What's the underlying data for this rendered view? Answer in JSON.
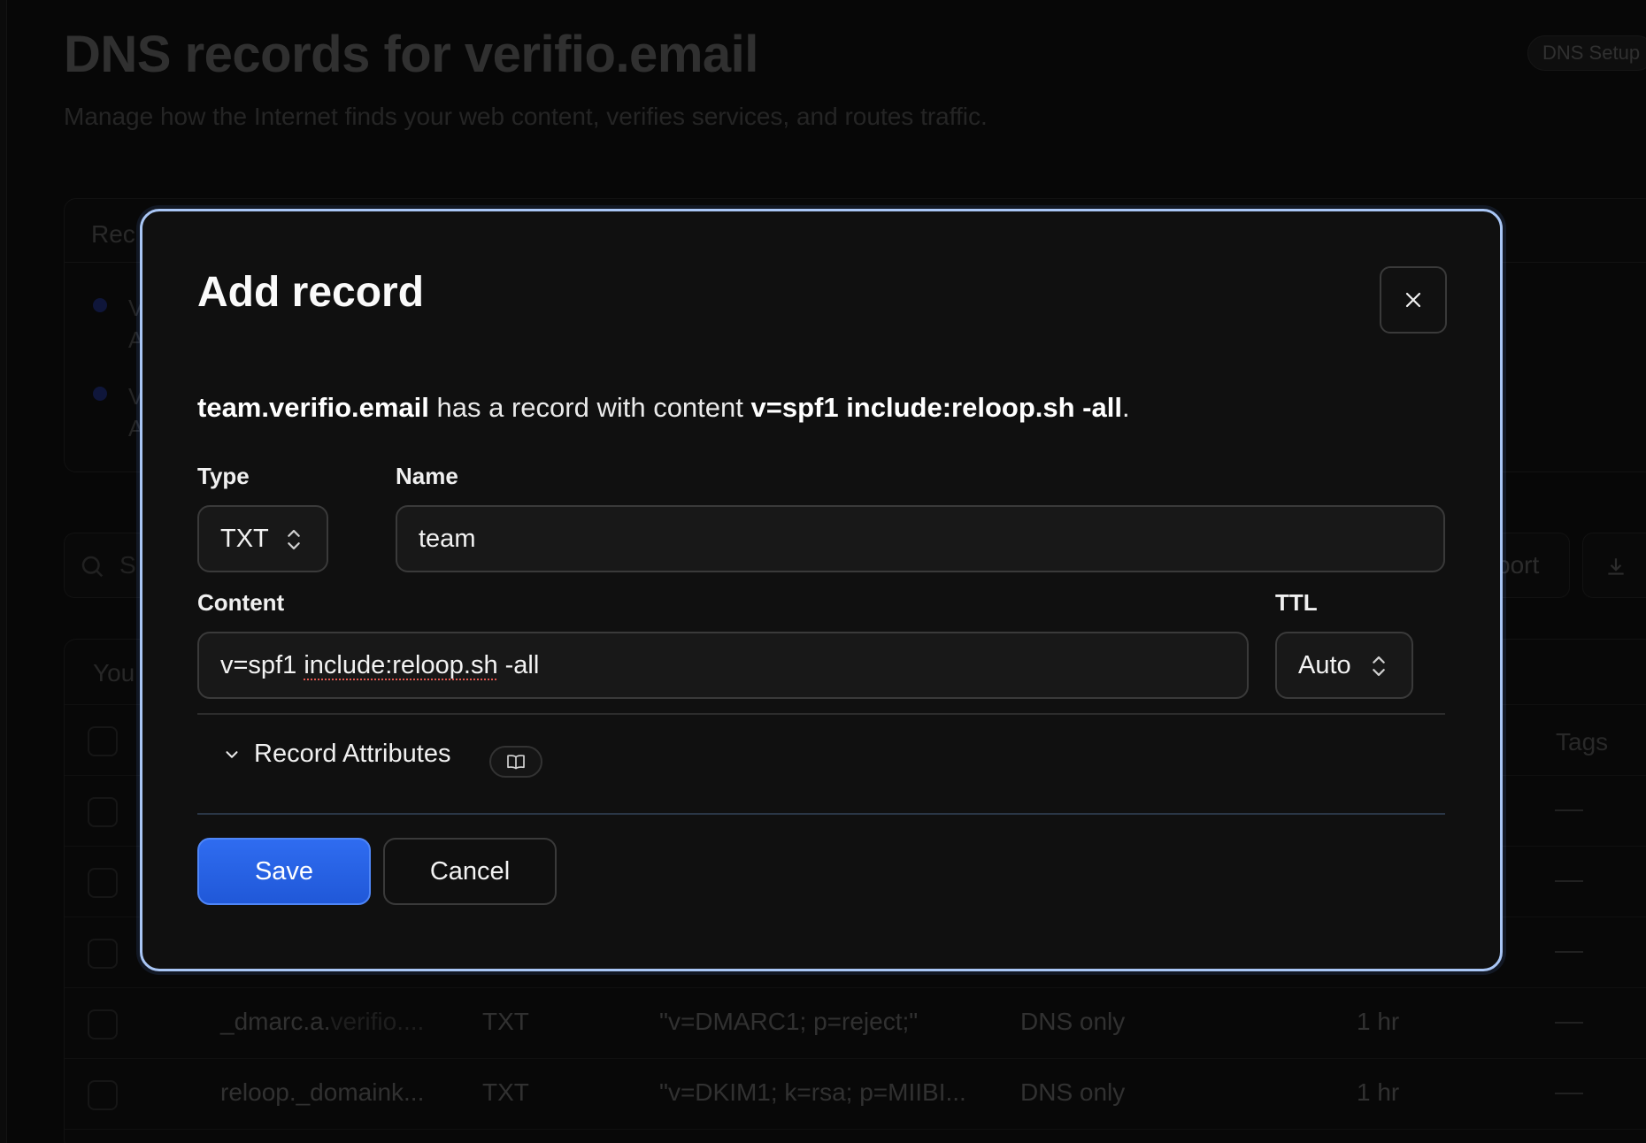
{
  "background": {
    "page_title": "DNS records for verifio.email",
    "page_subtitle": "Manage how the Internet finds your web content, verifies services, and routes traffic.",
    "badge": "DNS Setup",
    "panel_header": "Rec",
    "panel_items": [
      {
        "line1": "V",
        "line2": "A"
      },
      {
        "line1": "V",
        "line2": "A"
      }
    ],
    "search_placeholder": "S",
    "import_label": "port",
    "export_label": "E",
    "table_caption": "You",
    "tags_header": "Tags",
    "rows": [
      {
        "name": "_dmarc.a.",
        "name_dim": "verifio....",
        "type": "TXT",
        "content": "\"v=DMARC1; p=reject;\"",
        "proxy": "DNS only",
        "ttl": "1 hr",
        "tags": "—"
      },
      {
        "name": "reloop._domaink...",
        "name_dim": "",
        "type": "TXT",
        "content": "\"v=DKIM1; k=rsa; p=MIIBI...",
        "proxy": "DNS only",
        "ttl": "1 hr",
        "tags": "—"
      }
    ]
  },
  "modal": {
    "title": "Add record",
    "description": {
      "name": "team.verifio.email",
      "middle": " has a record with content ",
      "content": "v=spf1 include:reloop.sh -all",
      "end": "."
    },
    "type_label": "Type",
    "type_value": "TXT",
    "name_label": "Name",
    "name_value": "team",
    "content_label": "Content",
    "content_value_part1": "v=spf1 ",
    "content_value_squiggle": "include:reloop.sh",
    "content_value_part2": " -all",
    "ttl_label": "TTL",
    "ttl_value": "Auto",
    "attributes_label": "Record Attributes",
    "save_label": "Save",
    "cancel_label": "Cancel"
  },
  "icons": {
    "close": "close-icon",
    "chevron_updown": "chevron-updown-icon",
    "chevron_down": "chevron-down-icon",
    "book": "book-icon",
    "search": "search-icon",
    "download": "download-icon"
  },
  "colors": {
    "modal_border": "#a9c6f5",
    "primary": "#2563eb",
    "background": "#0b0b0b"
  }
}
